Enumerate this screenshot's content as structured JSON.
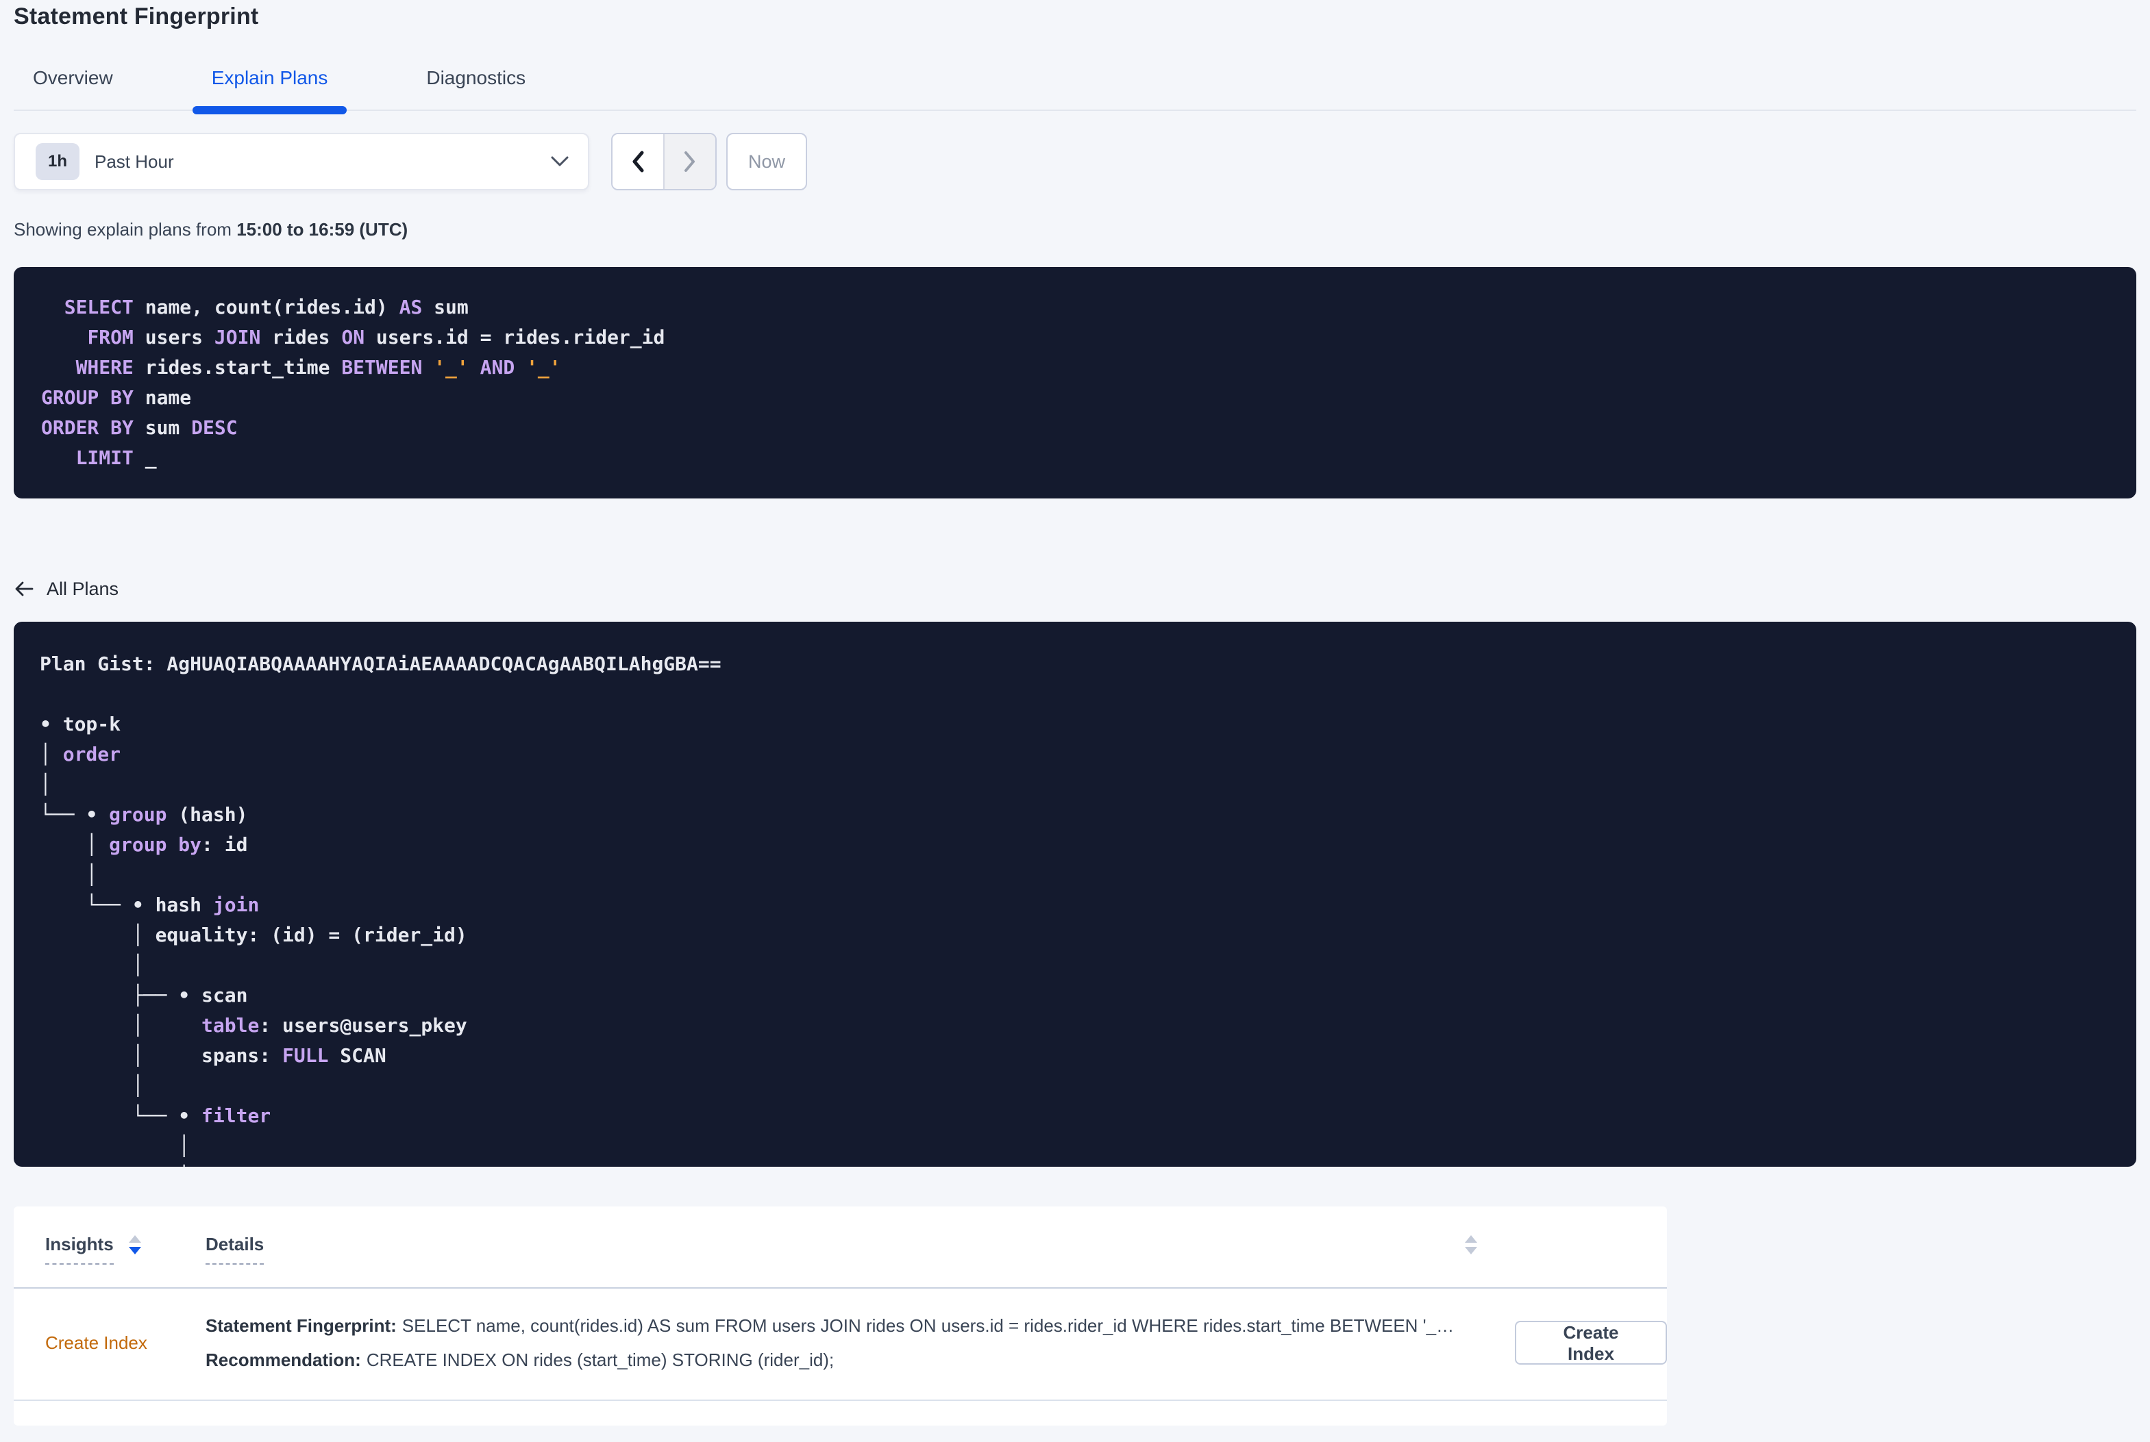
{
  "page_title": "Statement Fingerprint",
  "tabs": [
    {
      "label": "Overview",
      "active": false
    },
    {
      "label": "Explain Plans",
      "active": true
    },
    {
      "label": "Diagnostics",
      "active": false
    }
  ],
  "time_controls": {
    "badge": "1h",
    "range_label": "Past Hour",
    "now_label": "Now",
    "prev_enabled": true,
    "next_enabled": false
  },
  "showing": {
    "prefix": "Showing explain plans from ",
    "bold": "15:00 to 16:59 (UTC)"
  },
  "sql": {
    "lines": [
      [
        [
          "t",
          "  "
        ],
        [
          "k",
          "SELECT"
        ],
        [
          "t",
          " name, count(rides.id) "
        ],
        [
          "k",
          "AS"
        ],
        [
          "t",
          " sum"
        ]
      ],
      [
        [
          "t",
          "    "
        ],
        [
          "k",
          "FROM"
        ],
        [
          "t",
          " users "
        ],
        [
          "k",
          "JOIN"
        ],
        [
          "t",
          " rides "
        ],
        [
          "k",
          "ON"
        ],
        [
          "t",
          " users.id = rides.rider_id"
        ]
      ],
      [
        [
          "t",
          "   "
        ],
        [
          "k",
          "WHERE"
        ],
        [
          "t",
          " rides.start_time "
        ],
        [
          "k",
          "BETWEEN"
        ],
        [
          "t",
          " "
        ],
        [
          "s",
          "'_'"
        ],
        [
          "t",
          " "
        ],
        [
          "k",
          "AND"
        ],
        [
          "t",
          " "
        ],
        [
          "s",
          "'_'"
        ]
      ],
      [
        [
          "k",
          "GROUP BY"
        ],
        [
          "t",
          " name"
        ]
      ],
      [
        [
          "k",
          "ORDER BY"
        ],
        [
          "t",
          " sum "
        ],
        [
          "k",
          "DESC"
        ]
      ],
      [
        [
          "t",
          "   "
        ],
        [
          "k",
          "LIMIT"
        ],
        [
          "t",
          " _"
        ]
      ]
    ]
  },
  "all_plans_label": "All Plans",
  "plan": {
    "gist": "AgHUAQIABQAAAAHYAQIAiAEAAAADCQACAgAABQILAhgGBA==",
    "lines": [
      [
        [
          "t",
          "Plan Gist: AgHUAQIABQAAAAHYAQIAiAEAAAADCQACAgAABQILAhgGBA=="
        ]
      ],
      [],
      [
        [
          "t",
          "• top-k"
        ]
      ],
      [
        [
          "t",
          "│ "
        ],
        [
          "k",
          "order"
        ]
      ],
      [
        [
          "t",
          "│"
        ]
      ],
      [
        [
          "t",
          "└── • "
        ],
        [
          "k",
          "group"
        ],
        [
          "t",
          " (hash)"
        ]
      ],
      [
        [
          "t",
          "    │ "
        ],
        [
          "k",
          "group by"
        ],
        [
          "t",
          ": id"
        ]
      ],
      [
        [
          "t",
          "    │"
        ]
      ],
      [
        [
          "t",
          "    └── • hash "
        ],
        [
          "k",
          "join"
        ]
      ],
      [
        [
          "t",
          "        │ equality: (id) = (rider_id)"
        ]
      ],
      [
        [
          "t",
          "        │"
        ]
      ],
      [
        [
          "t",
          "        ├── • scan"
        ]
      ],
      [
        [
          "t",
          "        │     "
        ],
        [
          "k",
          "table"
        ],
        [
          "t",
          ": users@users_pkey"
        ]
      ],
      [
        [
          "t",
          "        │     spans: "
        ],
        [
          "k",
          "FULL"
        ],
        [
          "t",
          " SCAN"
        ]
      ],
      [
        [
          "t",
          "        │"
        ]
      ],
      [
        [
          "t",
          "        └── • "
        ],
        [
          "k",
          "filter"
        ]
      ],
      [
        [
          "t",
          "            │"
        ]
      ],
      [
        [
          "t",
          "            │"
        ]
      ]
    ]
  },
  "insights_table": {
    "headers": [
      {
        "label": "Insights",
        "sort": "desc"
      },
      {
        "label": "Details",
        "sort": "none"
      }
    ],
    "rows": [
      {
        "insight": "Create Index",
        "detail_lines": [
          {
            "label": "Statement Fingerprint:",
            "text": "SELECT name, count(rides.id) AS sum FROM users JOIN rides ON users.id = rides.rider_id WHERE rides.start_time BETWEEN '_' AND '_' GROUP BY name ORDER BY sum DESC LIMIT _"
          },
          {
            "label": "Recommendation:",
            "text": "CREATE INDEX ON rides (start_time) STORING (rider_id);"
          }
        ],
        "action_label": "Create Index"
      }
    ]
  },
  "colors": {
    "accent_blue": "#1158e8",
    "code_background": "#141a2e",
    "code_keyword": "#c7a5f1",
    "code_text": "#e7e9f0",
    "code_literal": "#f0a33c",
    "insight_link_orange": "#c2690a"
  }
}
